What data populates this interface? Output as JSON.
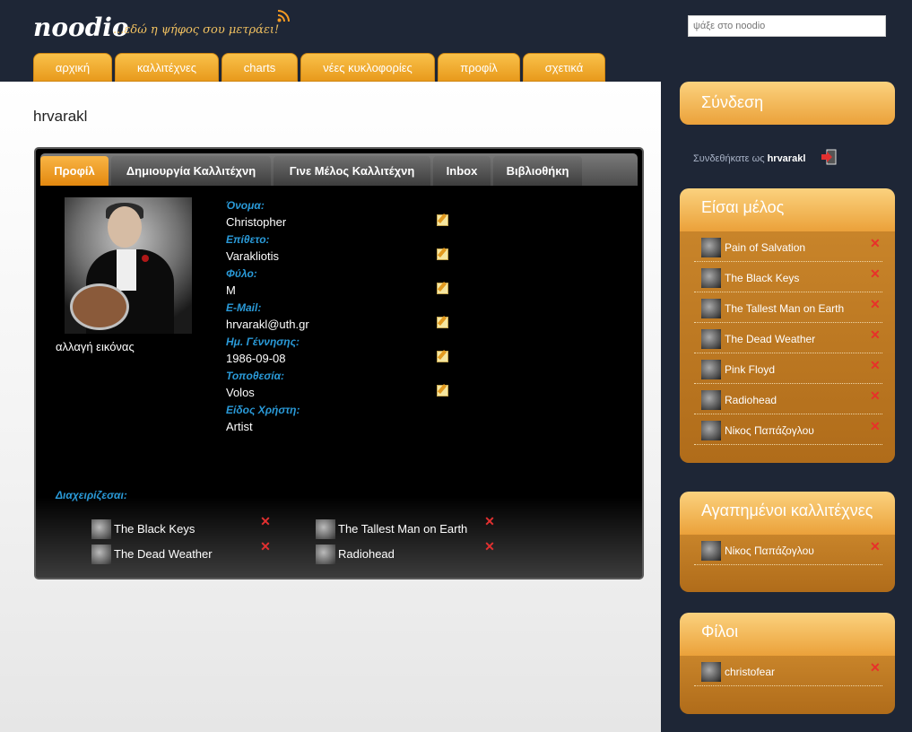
{
  "header": {
    "logo": "noodio",
    "tagline": "...εδώ η ψήφος σου μετράει!",
    "search_placeholder": "ψάξε στο noodio"
  },
  "nav": [
    "αρχική",
    "καλλιτέχνες",
    "charts",
    "νέες κυκλοφορίες",
    "προφίλ",
    "σχετικά"
  ],
  "page": {
    "username": "hrvarakl"
  },
  "profile_tabs": [
    "Προφίλ",
    "Δημιουργία Καλλιτέχνη",
    "Γινε Μέλος Καλλιτέχνη",
    "Inbox",
    "Βιβλιοθήκη"
  ],
  "profile": {
    "change_picture": "αλλαγή εικόνας",
    "fields": [
      {
        "label": "Όνομα:",
        "value": "Christopher",
        "editable": true
      },
      {
        "label": "Επίθετο:",
        "value": "Varakliotis",
        "editable": true
      },
      {
        "label": "Φύλο:",
        "value": "M",
        "editable": true
      },
      {
        "label": "E-Mail:",
        "value": "hrvarakl@uth.gr",
        "editable": true
      },
      {
        "label": "Ημ. Γέννησης:",
        "value": "1986-09-08",
        "editable": true
      },
      {
        "label": "Τοποθεσία:",
        "value": "Volos",
        "editable": true
      },
      {
        "label": "Είδος Χρήστη:",
        "value": "Artist",
        "editable": false
      }
    ],
    "manages_label": "Διαχειρίζεσαι:",
    "manages": [
      "The Black Keys",
      "The Tallest Man on Earth",
      "The Dead Weather",
      "Radiohead"
    ]
  },
  "sidebar": {
    "login_title": "Σύνδεση",
    "logged_in_prefix": "Συνδεθήκατε ως",
    "logged_in_user": "hrvarakl",
    "member_title": "Είσαι μέλος",
    "member_of": [
      "Pain of Salvation",
      "The Black Keys",
      "The Tallest Man on Earth",
      "The Dead Weather",
      "Pink Floyd",
      "Radiohead",
      "Νίκος Παπάζογλου"
    ],
    "favorites_title": "Αγαπημένοι καλλιτέχνες",
    "favorites": [
      "Νίκος Παπάζογλου"
    ],
    "friends_title": "Φίλοι",
    "friends": [
      "christofear"
    ]
  },
  "colors": {
    "accent_orange": "#eba13a",
    "label_blue": "#2a9ad8",
    "delete_red": "#e23030",
    "background_navy": "#1e2636"
  }
}
